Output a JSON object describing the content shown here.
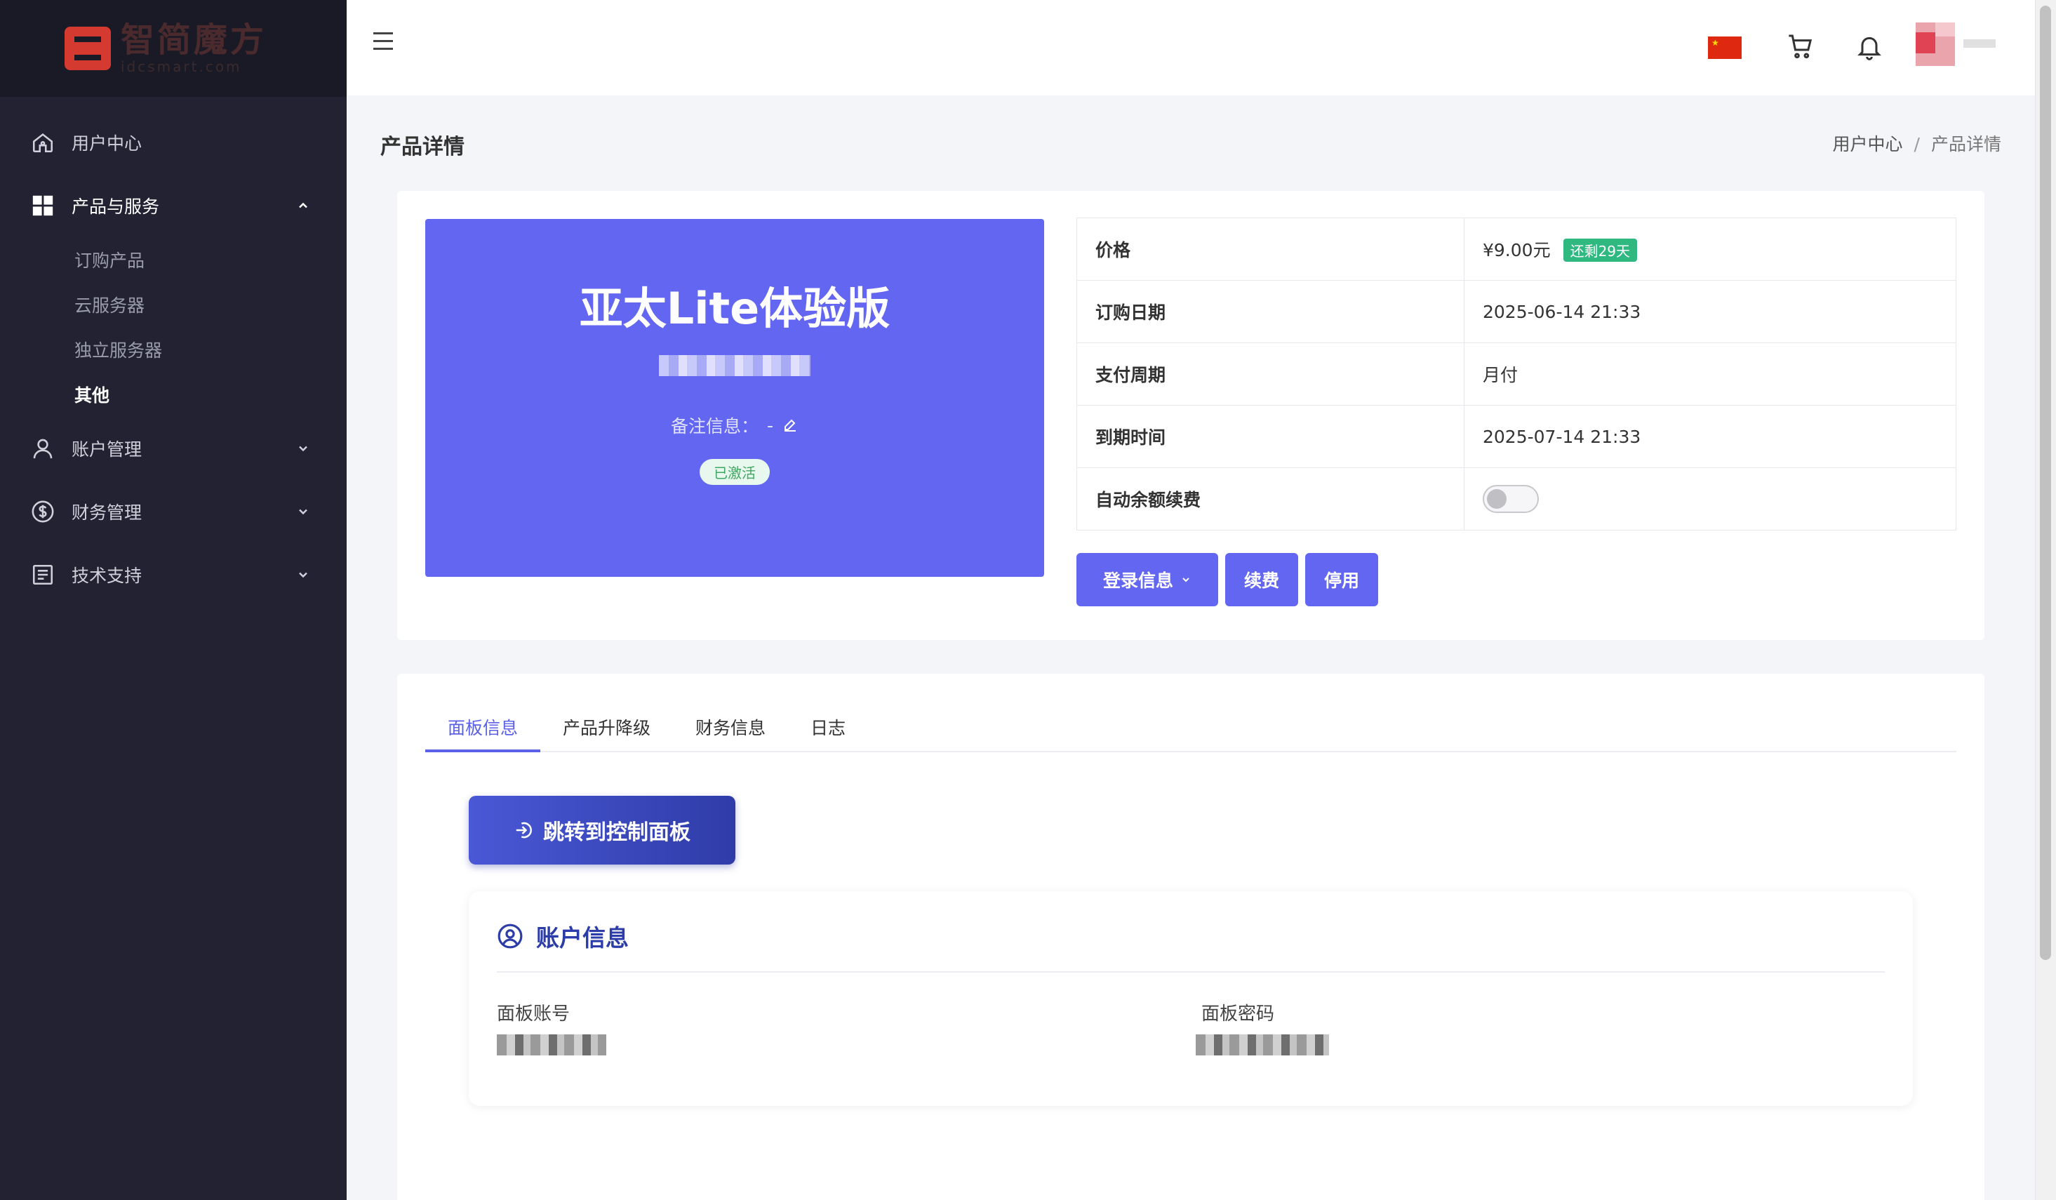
{
  "sidebar": {
    "logo": {
      "brand": "智简魔方",
      "domain": "idcsmart.com"
    },
    "items": [
      {
        "label": "用户中心",
        "icon": "home-icon"
      },
      {
        "label": "产品与服务",
        "icon": "grid-icon",
        "expanded": true,
        "children": [
          {
            "label": "订购产品"
          },
          {
            "label": "云服务器"
          },
          {
            "label": "独立服务器"
          },
          {
            "label": "其他",
            "active": true
          }
        ]
      },
      {
        "label": "账户管理",
        "icon": "user-icon"
      },
      {
        "label": "财务管理",
        "icon": "dollar-icon"
      },
      {
        "label": "技术支持",
        "icon": "document-icon"
      }
    ]
  },
  "header": {
    "flag": "china-flag-icon",
    "cart": "cart-icon",
    "bell": "bell-icon"
  },
  "page": {
    "title": "产品详情",
    "breadcrumb": [
      "用户中心",
      "产品详情"
    ],
    "breadcrumb_sep": "/"
  },
  "product": {
    "name": "亚太Lite体验版",
    "note_label": "备注信息：",
    "note_value": "-",
    "status": "已激活"
  },
  "details": [
    {
      "key": "价格",
      "value": "¥9.00元",
      "badge": "还剩29天"
    },
    {
      "key": "订购日期",
      "value": "2025-06-14 21:33"
    },
    {
      "key": "支付周期",
      "value": "月付"
    },
    {
      "key": "到期时间",
      "value": "2025-07-14 21:33"
    },
    {
      "key": "自动余额续费",
      "toggle": false
    }
  ],
  "actions": {
    "login_info": "登录信息",
    "renew": "续费",
    "disable": "停用"
  },
  "tabs": [
    "面板信息",
    "产品升降级",
    "财务信息",
    "日志"
  ],
  "panel": {
    "jump_button": "跳转到控制面板",
    "account_title": "账户信息",
    "account_label": "面板账号",
    "password_label": "面板密码"
  },
  "colors": {
    "accent": "#6366f1",
    "sidebar": "#222232",
    "success": "#2fb880"
  }
}
